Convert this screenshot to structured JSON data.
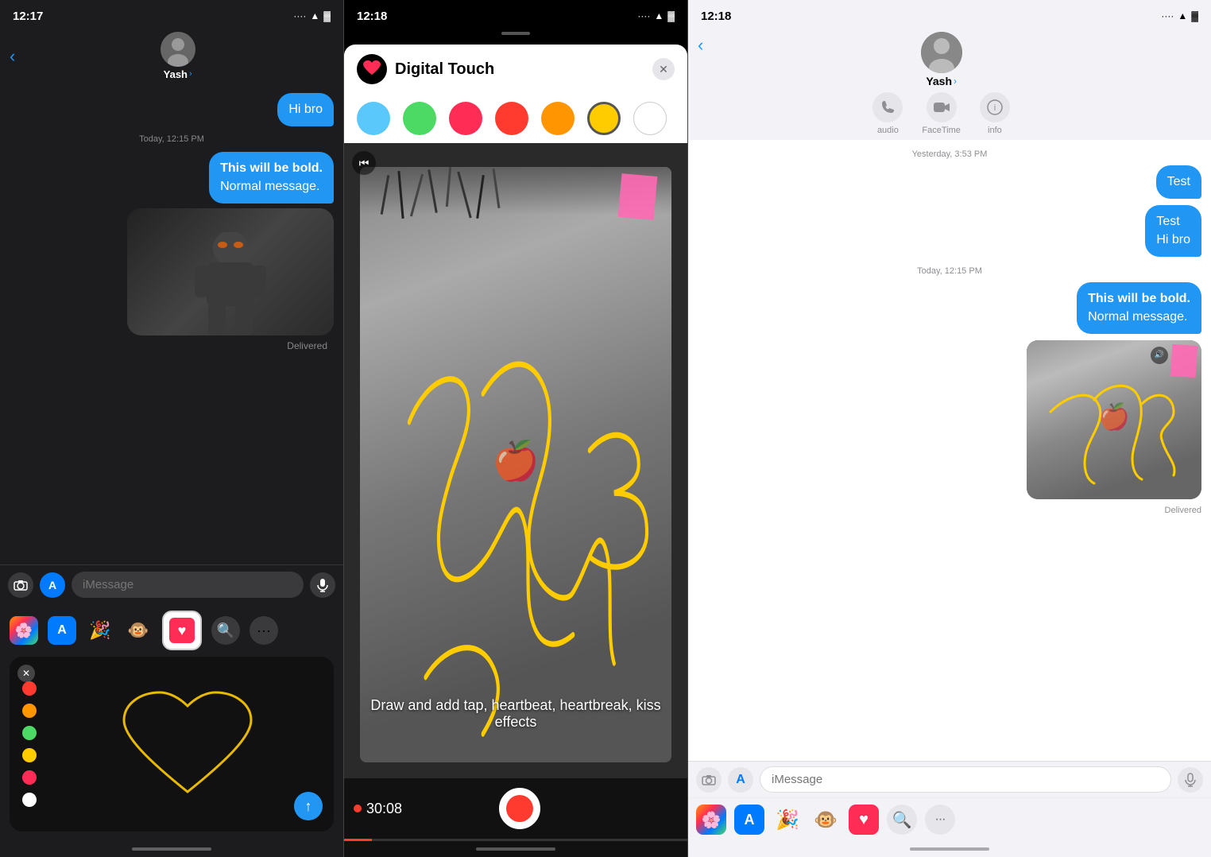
{
  "panel1": {
    "status_time": "12:17",
    "contact_name": "Yash",
    "messages": [
      {
        "type": "sent",
        "text": "Hi bro",
        "align": "right"
      },
      {
        "type": "time",
        "text": "Today, 12:15 PM"
      },
      {
        "type": "sent",
        "text": "This will be bold.\nNormal message.",
        "align": "right"
      },
      {
        "type": "image"
      },
      {
        "type": "status",
        "text": "Delivered"
      }
    ],
    "input_placeholder": "iMessage",
    "dt_mini": {
      "colors": [
        "#ff3b30",
        "#ff9500",
        "#ffcc00",
        "#4cd964",
        "#007aff",
        "#ffffff"
      ],
      "caption": ""
    }
  },
  "panel2": {
    "status_time": "12:18",
    "title": "Digital Touch",
    "close_label": "✕",
    "colors": [
      "#5ac8fa",
      "#4cd964",
      "#ff2d55",
      "#ff3b30",
      "#ff9500",
      "#ffcc00",
      "#ffffff"
    ],
    "caption": "Draw and add tap, heartbeat, heartbreak,\nkiss effects",
    "timer": "30:08",
    "progress_pct": 8
  },
  "panel3": {
    "status_time": "12:18",
    "contact_name": "Yash",
    "actions": [
      {
        "icon": "📞",
        "label": "audio"
      },
      {
        "icon": "📹",
        "label": "FaceTime"
      },
      {
        "icon": "ℹ️",
        "label": "info"
      }
    ],
    "messages": [
      {
        "type": "time",
        "text": "Yesterday, 3:53 PM"
      },
      {
        "type": "sent",
        "text": "Test",
        "align": "right"
      },
      {
        "type": "sent",
        "text": "Test\nHi bro",
        "align": "right"
      },
      {
        "type": "time",
        "text": "Today, 12:15 PM"
      },
      {
        "type": "sent",
        "text": "This will be bold.\nNormal message.",
        "align": "right"
      },
      {
        "type": "image"
      },
      {
        "type": "status",
        "text": "Delivered"
      }
    ],
    "input_placeholder": "iMessage"
  }
}
